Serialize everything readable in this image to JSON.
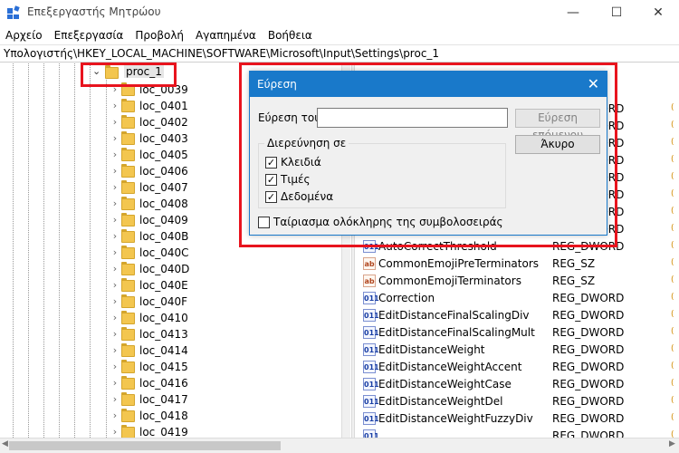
{
  "window": {
    "title": "Επεξεργαστής Μητρώου",
    "controls": {
      "minimize": "—",
      "maximize": "☐",
      "close": "✕"
    }
  },
  "menu": [
    "Αρχείο",
    "Επεξεργασία",
    "Προβολή",
    "Αγαπημένα",
    "Βοήθεια"
  ],
  "address_path": "Υπολογιστής\\HKEY_LOCAL_MACHINE\\SOFTWARE\\Microsoft\\Input\\Settings\\proc_1",
  "tree": {
    "selected": "proc_1",
    "children": [
      "loc_0039",
      "loc_0401",
      "loc_0402",
      "loc_0403",
      "loc_0405",
      "loc_0406",
      "loc_0407",
      "loc_0408",
      "loc_0409",
      "loc_040B",
      "loc_040C",
      "loc_040D",
      "loc_040E",
      "loc_040F",
      "loc_0410",
      "loc_0413",
      "loc_0414",
      "loc_0415",
      "loc_0416",
      "loc_0417",
      "loc_0418",
      "loc_0419"
    ]
  },
  "values": [
    {
      "name": "",
      "type": "REG_DWORD",
      "icon": "num"
    },
    {
      "name": "",
      "type": "REG_DWORD",
      "icon": "num"
    },
    {
      "name": "",
      "type": "REG_DWORD",
      "icon": "num"
    },
    {
      "name": "",
      "type": "REG_DWORD",
      "icon": "num"
    },
    {
      "name": "",
      "type": "REG_DWORD",
      "icon": "num"
    },
    {
      "name": "",
      "type": "REG_DWORD",
      "icon": "num"
    },
    {
      "name": "",
      "type": "REG_DWORD",
      "icon": "num"
    },
    {
      "name": "",
      "type": "REG_DWORD",
      "icon": "num"
    },
    {
      "name": "AutoCorrectThreshold",
      "type": "REG_DWORD",
      "icon": "num"
    },
    {
      "name": "CommonEmojiPreTerminators",
      "type": "REG_SZ",
      "icon": "str"
    },
    {
      "name": "CommonEmojiTerminators",
      "type": "REG_SZ",
      "icon": "str"
    },
    {
      "name": "Correction",
      "type": "REG_DWORD",
      "icon": "num"
    },
    {
      "name": "EditDistanceFinalScalingDiv",
      "type": "REG_DWORD",
      "icon": "num"
    },
    {
      "name": "EditDistanceFinalScalingMult",
      "type": "REG_DWORD",
      "icon": "num"
    },
    {
      "name": "EditDistanceWeight",
      "type": "REG_DWORD",
      "icon": "num"
    },
    {
      "name": "EditDistanceWeightAccent",
      "type": "REG_DWORD",
      "icon": "num"
    },
    {
      "name": "EditDistanceWeightCase",
      "type": "REG_DWORD",
      "icon": "num"
    },
    {
      "name": "EditDistanceWeightDel",
      "type": "REG_DWORD",
      "icon": "num"
    },
    {
      "name": "EditDistanceWeightFuzzyDiv",
      "type": "REG_DWORD",
      "icon": "num"
    },
    {
      "name": "",
      "type": "REG_DWORD",
      "icon": "num"
    }
  ],
  "find_dialog": {
    "title": "Εύρεση",
    "find_label": "Εύρεση του:",
    "find_value": "",
    "find_next_label": "Εύρεση επόμενου",
    "cancel_label": "Άκυρο",
    "look_at_label": "Διερεύνηση σε",
    "checkboxes": [
      {
        "label": "Κλειδιά",
        "checked": true
      },
      {
        "label": "Τιμές",
        "checked": true
      },
      {
        "label": "Δεδομένα",
        "checked": true
      }
    ],
    "match_whole": {
      "label": "Ταίριασμα ολόκληρης της συμβολοσειράς",
      "checked": false
    }
  },
  "highlight_color": "#e8141e",
  "accent": "#1979ca"
}
